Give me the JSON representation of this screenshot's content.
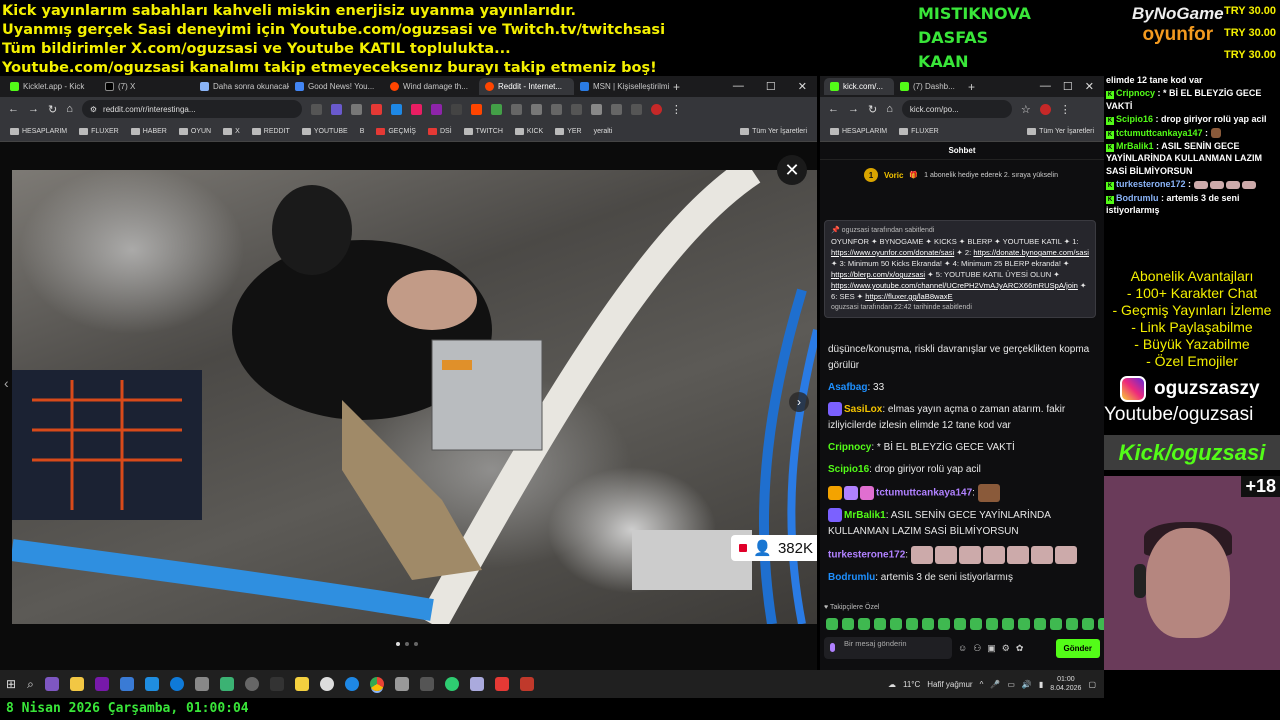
{
  "overlay": {
    "lines": [
      "Kick yayınlarım sabahları kahveli miskin enerjisiz uyanma yayınlarıdır.",
      "Uyanmış gerçek Sasi deneyimi için Youtube.com/oguzsasi ve Twitch.tv/twitchsasi",
      "Tüm bildirimler X.com/oguzsasi ve Youtube KATIL toplulukta...",
      "Youtube.com/oguzsasi kanalımı takip etmeyeceksenız burayı takip etmeniz boş!"
    ],
    "top_names": [
      "MISTIKNOVA",
      "DASFAS",
      "KAAN"
    ],
    "sponsor_by": "ByNoGame",
    "sponsor_oy": "oyunfor",
    "try_values": [
      "TRY 30.00",
      "TRY 30.00",
      "TRY 30.00"
    ]
  },
  "browser1": {
    "tabs": [
      "Kicklet.app - Kick",
      "(7) X",
      "Daha sonra okunacaklar",
      "Good News! You...",
      "Wind damage th...",
      "Reddit - Internet...",
      "MSN | Kişiselleştirilmiş..."
    ],
    "url": "reddit.com/r/interestinga...",
    "bookmarks": [
      "HESAPLARIM",
      "FLUXER",
      "HABER",
      "OYUN",
      "X",
      "REDDIT",
      "YOUTUBE",
      "B",
      "GEÇMİŞ",
      "DSİ",
      "TWITCH",
      "KICK",
      "YER",
      "yeralti",
      "Tüm Yer İşaretleri"
    ],
    "viewer_count": "382K"
  },
  "browser2": {
    "tabs": [
      "kick.com/...",
      "(7) Dashb..."
    ],
    "url": "kick.com/po...",
    "bookmarks": [
      "HESAPLARIM",
      "FLUXER",
      "Tüm Yer İşaretleri"
    ],
    "chat_title": "Sohbet",
    "sub_name": "Voric",
    "sub_rank": "1",
    "sub_text": "1 abonelik hediye ederek 2. sıraya yükselin",
    "pinned_by": "oguzsasi tarafından sabitlendi",
    "pinned_text": "OYUNFOR ✦ BYNOGAME ✦ KICKS ✦ BLERP ✦ YOUTUBE KATIL ✦ 1:",
    "pinned_link1": "https://www.oyunfor.com/donate/sasi",
    "pinned_mid1": "✦ 2:",
    "pinned_link2": "https://donate.bynogame.com/sasi",
    "pinned_mid2": "✦ 3: Minimum 50 Kicks Ekranda! ✦ 4: Minimum 25 BLERP ekranda! ✦",
    "pinned_link3": "https://blerp.com/x/oguzsasi",
    "pinned_mid3": "✦ 5: YOUTUBE KATIL ÜYESİ OLUN ✦",
    "pinned_link4": "https://www.youtube.com/channel/UCrePH2VmAJyARCX66mRUSpA/join",
    "pinned_mid4": "✦ 6: SES ✦",
    "pinned_link5": "https://fluxer.gg/laB8waxE",
    "pinned_footer": "oguzsasi tarafından 22:42 tarihinde sabitlendi",
    "messages": [
      {
        "user": "",
        "color": "#e9e9e9",
        "text": "düşünce/konuşma, riskli davranışlar ve gerçeklikten kopma görülür"
      },
      {
        "user": "Asafbag",
        "color": "#1e90ff",
        "text": "33"
      },
      {
        "user": "SasiLox",
        "color": "#f4c400",
        "text": "elmas yayın açma o zaman atarım. fakir izliyicilerde izlesin elimde 12 tane kod var"
      },
      {
        "user": "Cripnocy",
        "color": "#53fc18",
        "text": "* Bİ EL BLEYZİG GECE VAKTİ"
      },
      {
        "user": "Scipio16",
        "color": "#53fc18",
        "text": "drop giriyor rolü yap acil"
      },
      {
        "user": "tctumuttcankaya147",
        "color": "#b081ff",
        "text": ""
      },
      {
        "user": "MrBalik1",
        "color": "#53fc18",
        "text": "ASIL SENİN GECE YAYİNLARİNDA KULLANMAN LAZIM SASİ BİLMİYORSUN"
      },
      {
        "user": "turkesterone172",
        "color": "#b081ff",
        "text": ""
      },
      {
        "user": "Bodrumlu",
        "color": "#1e90ff",
        "text": "artemis 3 de seni istiyorlarmış"
      }
    ],
    "followers_label": "Takipçilere Özel",
    "input_placeholder": "Bir mesaj gönderin",
    "send_label": "Gönder"
  },
  "side_chat": [
    {
      "user": "",
      "text": "elimde 12 tane kod var"
    },
    {
      "user": "Cripnocy",
      "text": "* Bİ EL BLEYZİG GECE VAKTİ"
    },
    {
      "user": "Scipio16",
      "text": "drop giriyor rolü yap acil"
    },
    {
      "user": "tctumuttcankaya147",
      "text": ""
    },
    {
      "user": "MrBalik1",
      "text": "ASIL SENİN GECE YAYİNLARİNDA KULLANMAN LAZIM SASİ BİLMİYORSUN"
    },
    {
      "user": "turkesterone172",
      "text": ""
    },
    {
      "user": "Bodrumlu",
      "text": "artemis 3 de seni istiyorlarmış"
    }
  ],
  "benefits": [
    "Abonelik Avantajları",
    "- 100+ Karakter Chat",
    "- Geçmiş Yayınları İzleme",
    "- Link Paylaşabilme",
    "- Büyük Yazabilme",
    "- Özel Emojiler"
  ],
  "social": {
    "instagram": "oguzszaszy",
    "youtube": "Youtube/oguzsasi",
    "kick": "Kick/oguzsasi",
    "age": "+18"
  },
  "taskbar": {
    "weather": "11°C",
    "weather_text": "Hafif yağmur",
    "time": "01:00",
    "date": "8.04.2026"
  },
  "datebar": "8 Nisan 2026 Çarşamba, 01:00:04",
  "colors": {
    "overlay_yellow": "#f4f000",
    "kick_green": "#53fc18",
    "sponsor_orange": "#f39a1f"
  }
}
